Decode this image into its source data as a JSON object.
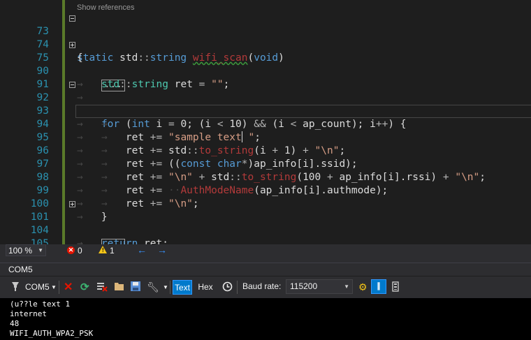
{
  "editor": {
    "codelens": "Show references",
    "lines": {
      "l73": "73",
      "l74": "74",
      "l75": "75",
      "l90": "90",
      "l91": "91",
      "l92": "92",
      "l93": "93",
      "l94": "94",
      "l95": "95",
      "l96": "96",
      "l97": "97",
      "l98": "98",
      "l99": "99",
      "l100": "100",
      "l101": "101",
      "l104": "104",
      "l105": "105"
    },
    "collapsed_marker": "..."
  },
  "status": {
    "zoom": "100 %",
    "errors": "0",
    "warnings": "1"
  },
  "serial": {
    "panel_title": "COM5",
    "port": "COM5",
    "text_button": "Text",
    "hex_button": "Hex",
    "baud_label": "Baud rate:",
    "baud_value": "115200",
    "output": [
      "(u??le text 1",
      "internet",
      "48",
      "WIFI_AUTH_WPA2_PSK",
      "…"
    ]
  },
  "colors": {
    "accent": "#007acc",
    "error": "#e51400",
    "warning": "#f5c518",
    "keyword": "#569cd6",
    "type": "#4ec9b0",
    "string": "#d69d85"
  }
}
